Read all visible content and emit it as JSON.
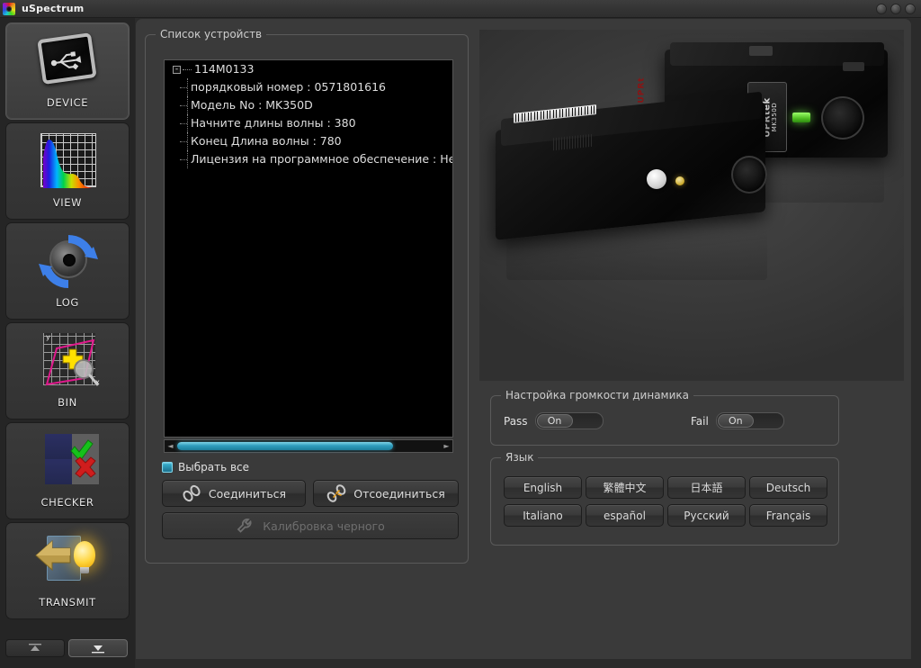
{
  "window": {
    "title": "uSpectrum",
    "app_icon": "color-wheel-icon",
    "controls": [
      "minimize-button",
      "maximize-button",
      "close-button"
    ]
  },
  "sidebar": {
    "items": [
      {
        "label": "DEVICE",
        "icon": "usb-device-icon",
        "active": true
      },
      {
        "label": "VIEW",
        "icon": "spectrum-chart-icon",
        "active": false
      },
      {
        "label": "LOG",
        "icon": "shutter-refresh-icon",
        "active": false
      },
      {
        "label": "BIN",
        "icon": "bin-chart-icon",
        "active": false
      },
      {
        "label": "CHECKER",
        "icon": "pass-fail-icon",
        "active": false
      },
      {
        "label": "TRANSMIT",
        "icon": "transmit-bulb-icon",
        "active": false
      }
    ],
    "scroll_up_icon": "scroll-up-arrow",
    "scroll_down_icon": "scroll-down-arrow"
  },
  "device_list": {
    "title": "Список устройств",
    "tree": {
      "root": "114M0133",
      "expander": "-",
      "children": [
        "порядковый номер : 0571801616",
        "Модель No : MK350D",
        "Начните длины волны : 380",
        "Конец Длина волны : 780",
        "Лицензия на программное обеспечение : Не"
      ]
    },
    "scrollbar": {
      "left_arrow": "◄",
      "right_arrow": "►"
    },
    "select_all": {
      "label": "Выбрать все",
      "checked": true
    },
    "buttons": {
      "connect": {
        "label": "Соединиться",
        "icon": "link-icon",
        "enabled": true
      },
      "disconnect": {
        "label": "Отсоединиться",
        "icon": "broken-link-icon",
        "enabled": true
      },
      "black_calibration": {
        "label": "Калибровка черного",
        "icon": "wrench-icon",
        "enabled": false
      }
    }
  },
  "device_photo": {
    "brand": "UPRtek",
    "model": "MK350D",
    "side_text": "UPRt"
  },
  "speaker_volume": {
    "title": "Настройка громкости динамика",
    "pass": {
      "label": "Pass",
      "state": "On"
    },
    "fail": {
      "label": "Fail",
      "state": "On"
    }
  },
  "language": {
    "title": "Язык",
    "options": [
      "English",
      "繁體中文",
      "日本語",
      "Deutsch",
      "Italiano",
      "español",
      "Русский",
      "Français"
    ]
  },
  "colors": {
    "accent": "#2f9dbd",
    "panel_bg": "#3a3a3a",
    "sidebar_bg": "#252525",
    "tree_bg": "#000000",
    "text": "#dedede"
  }
}
